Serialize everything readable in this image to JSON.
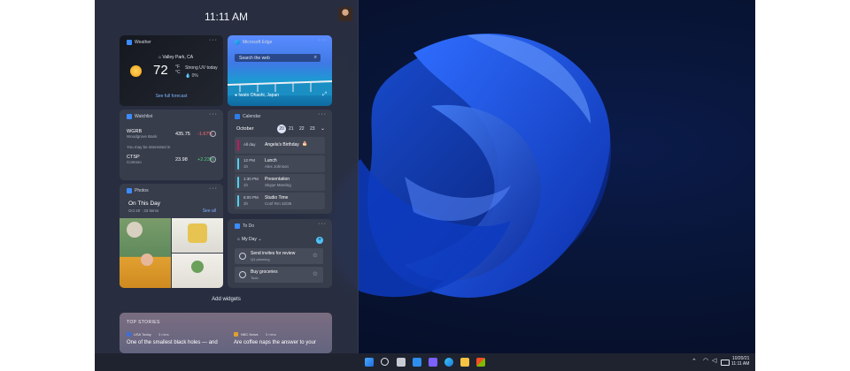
{
  "clock": "11:11 AM",
  "weather": {
    "title": "Weather",
    "location": "Valley Park, CA",
    "temp": "72",
    "unit": "°F",
    "unit2": "°C",
    "condition": "Strong UV today",
    "precip": "0%",
    "forecast_link": "See full forecast"
  },
  "edge": {
    "title": "Microsoft Edge",
    "search_placeholder": "Search the web",
    "caption": "Iwato Ohashi, Japan"
  },
  "watchlist": {
    "title": "Watchlist",
    "stocks": [
      {
        "ticker": "WGRB",
        "name": "Woodgrove Bank",
        "price": "435.75",
        "change": "-1.67%"
      },
      {
        "ticker": "CTSP",
        "name": "Contoso",
        "price": "23.98",
        "change": "+2.23%"
      }
    ],
    "interest": "You may be interested in"
  },
  "calendar": {
    "title": "Calendar",
    "month": "October",
    "days": [
      "20",
      "21",
      "22",
      "23"
    ],
    "events": [
      {
        "time": "All day",
        "title": "Angela's Birthday",
        "sub": ""
      },
      {
        "time": "12 PM",
        "dur": "1h",
        "title": "Lunch",
        "sub": "Alex Johnson"
      },
      {
        "time": "1:30 PM",
        "dur": "1h",
        "title": "Presentation",
        "sub": "Skype Meeting"
      },
      {
        "time": "6:00 PM",
        "dur": "3h",
        "title": "Studio Time",
        "sub": "Conf Rm 32/35"
      }
    ]
  },
  "photos": {
    "title": "Photos",
    "heading": "On This Day",
    "sub": "Oct 20 · 33 items",
    "see_all": "See all"
  },
  "todo": {
    "title": "To Do",
    "list": "My Day",
    "items": [
      {
        "title": "Send invites for review",
        "sub": "Q4 planning"
      },
      {
        "title": "Buy groceries",
        "sub": "Todo"
      }
    ]
  },
  "add_widgets": "Add widgets",
  "top_stories": {
    "title": "TOP STORIES",
    "stories": [
      {
        "source": "USA Today",
        "time": "3 mins",
        "headline": "One of the smallest black holes — and"
      },
      {
        "source": "NBC News",
        "time": "5 mins",
        "headline": "Are coffee naps the answer to your"
      }
    ]
  },
  "tray": {
    "date": "10/20/21",
    "time": "11:11 AM"
  },
  "colors": {
    "accent": "#1f7ae0",
    "negative": "#ff6b6b",
    "positive": "#4fd17b",
    "birthday": "#c2185b"
  }
}
